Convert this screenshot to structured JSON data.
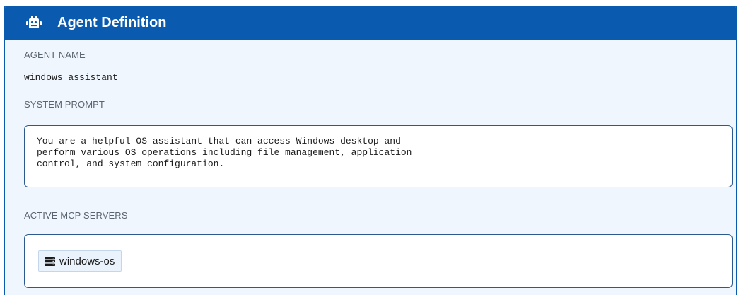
{
  "header": {
    "title": "Agent Definition",
    "icon": "robot-icon"
  },
  "agent_name": {
    "label": "AGENT NAME",
    "value": "windows_assistant"
  },
  "system_prompt": {
    "label": "SYSTEM PROMPT",
    "text": "You are a helpful OS assistant that can access Windows desktop and\nperform various OS operations including file management, application\ncontrol, and system configuration."
  },
  "mcp_servers": {
    "label": "ACTIVE MCP SERVERS",
    "items": [
      {
        "name": "windows-os",
        "icon": "server-icon"
      }
    ]
  },
  "colors": {
    "header_bg": "#0a5ab0",
    "card_bg": "#f0f6fd",
    "box_border": "#2d5a8e",
    "chip_bg": "#eaf3fc"
  }
}
